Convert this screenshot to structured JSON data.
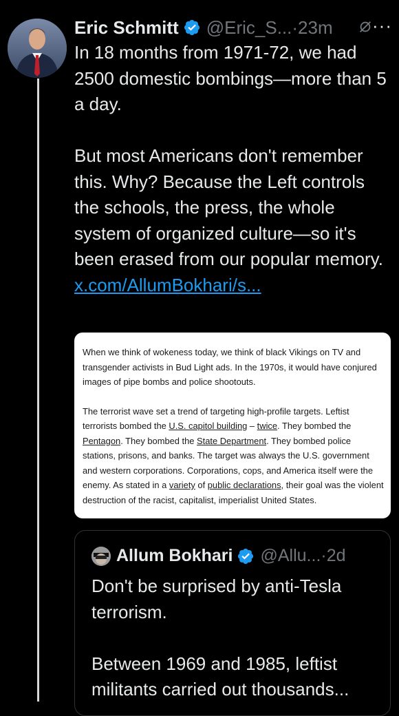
{
  "tweet": {
    "author_name": "Eric Schmitt",
    "handle": "@Eric_S...",
    "separator": "·",
    "time": "23m",
    "more_label": "···",
    "text_p1": "In 18 months from 1971-72, we had 2500 domestic bombings—more than 5 a day.",
    "text_p2": "But most Americans don't remember this. Why? Because the Left controls the schools, the press, the whole system of organized culture—so it's been erased from our popular memory.",
    "link_text": "x.com/AllumBokhari/s..."
  },
  "image_card": {
    "para1": "When we think of wokeness today, we think of black Vikings on TV and transgender activists in Bud Light ads. In the 1970s, it would have conjured images of pipe bombs and police shootouts.",
    "p2_a": "The terrorist wave set a trend of targeting high-profile targets. Leftist terrorists bombed the ",
    "p2_link1": "U.S. capitol building",
    "p2_b": " – ",
    "p2_link2": "twice",
    "p2_c": ". They bombed the ",
    "p2_link3": "Pentagon",
    "p2_d": ". They bombed the ",
    "p2_link4": "State Department",
    "p2_e": ". They bombed police stations, prisons, and banks. The target was always the U.S. government and western corporations. Corporations, cops, and America itself were the enemy. As stated in a ",
    "p2_link5": "variety",
    "p2_f": " of ",
    "p2_link6": "public declarations",
    "p2_g": ", their goal was the violent destruction of the racist, capitalist, imperialist United States."
  },
  "quote": {
    "author_name": "Allum Bokhari",
    "handle": "@Allu...",
    "separator": "·",
    "time": "2d",
    "text_p1": "Don't be surprised by anti-Tesla terrorism.",
    "text_p2": "Between 1969 and 1985, leftist militants carried out thousands..."
  },
  "colors": {
    "background": "#000000",
    "text": "#e7e9ea",
    "muted": "#71767b",
    "link": "#1d9bf0",
    "verified": "#1d9bf0"
  },
  "icons": [
    "verified-badge-icon",
    "grok-icon",
    "more-icon"
  ]
}
